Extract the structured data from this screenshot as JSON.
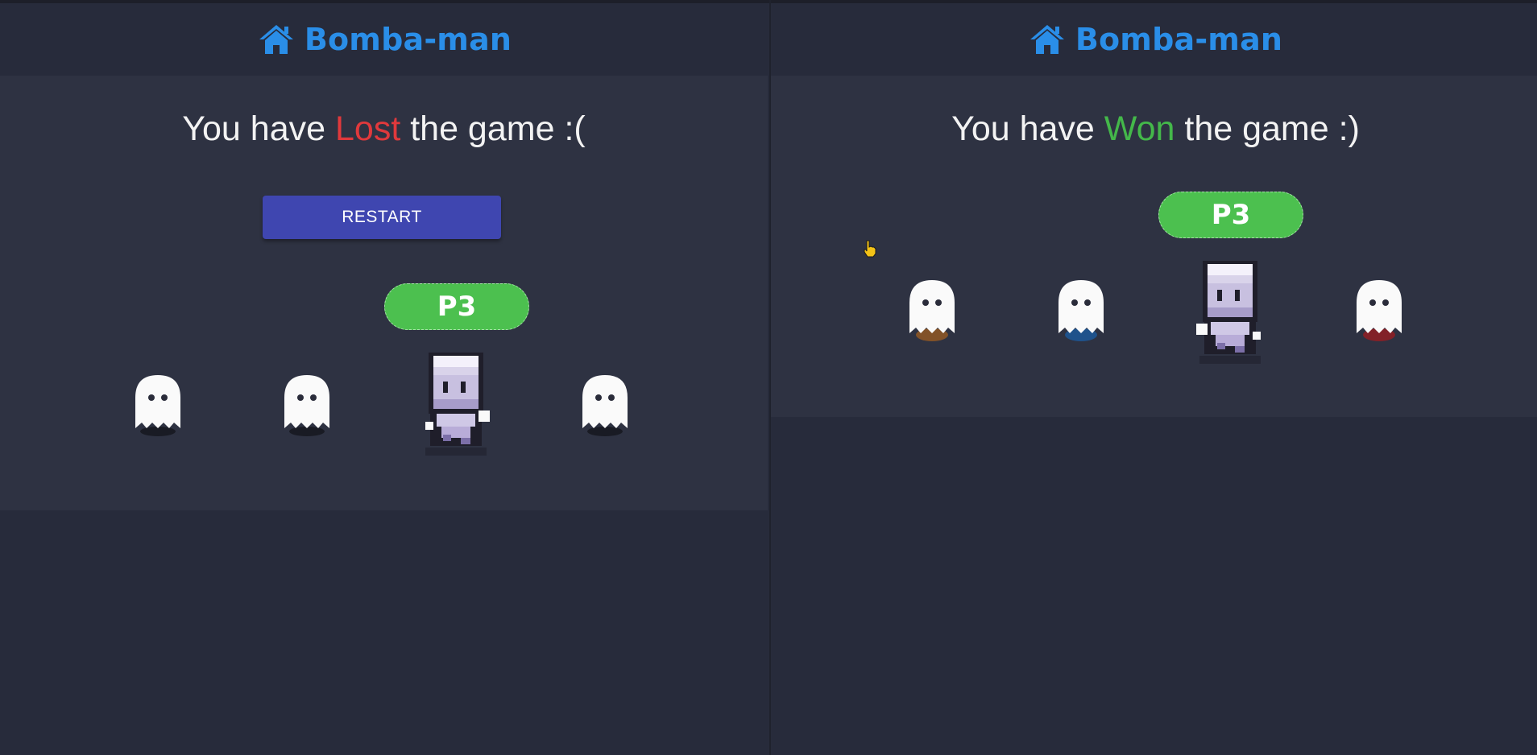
{
  "left_panel": {
    "header": {
      "icon": "home-icon",
      "brand": "Bomba-man"
    },
    "result": {
      "prefix": "You have ",
      "status": "Lost",
      "suffix": " the game :("
    },
    "restart_label": "RESTART",
    "player_tag": "P3"
  },
  "right_panel": {
    "header": {
      "icon": "home-icon",
      "brand": "Bomba-man"
    },
    "result": {
      "prefix": "You have ",
      "status": "Won",
      "suffix": " the game :)"
    },
    "player_tag": "P3"
  },
  "colors": {
    "brand": "#2a8ee8",
    "lost": "#e0393c",
    "won": "#44b84a",
    "tag": "#4cc04f",
    "button": "#3f46b0",
    "background": "#272b3b",
    "panel": "#2e3242"
  }
}
